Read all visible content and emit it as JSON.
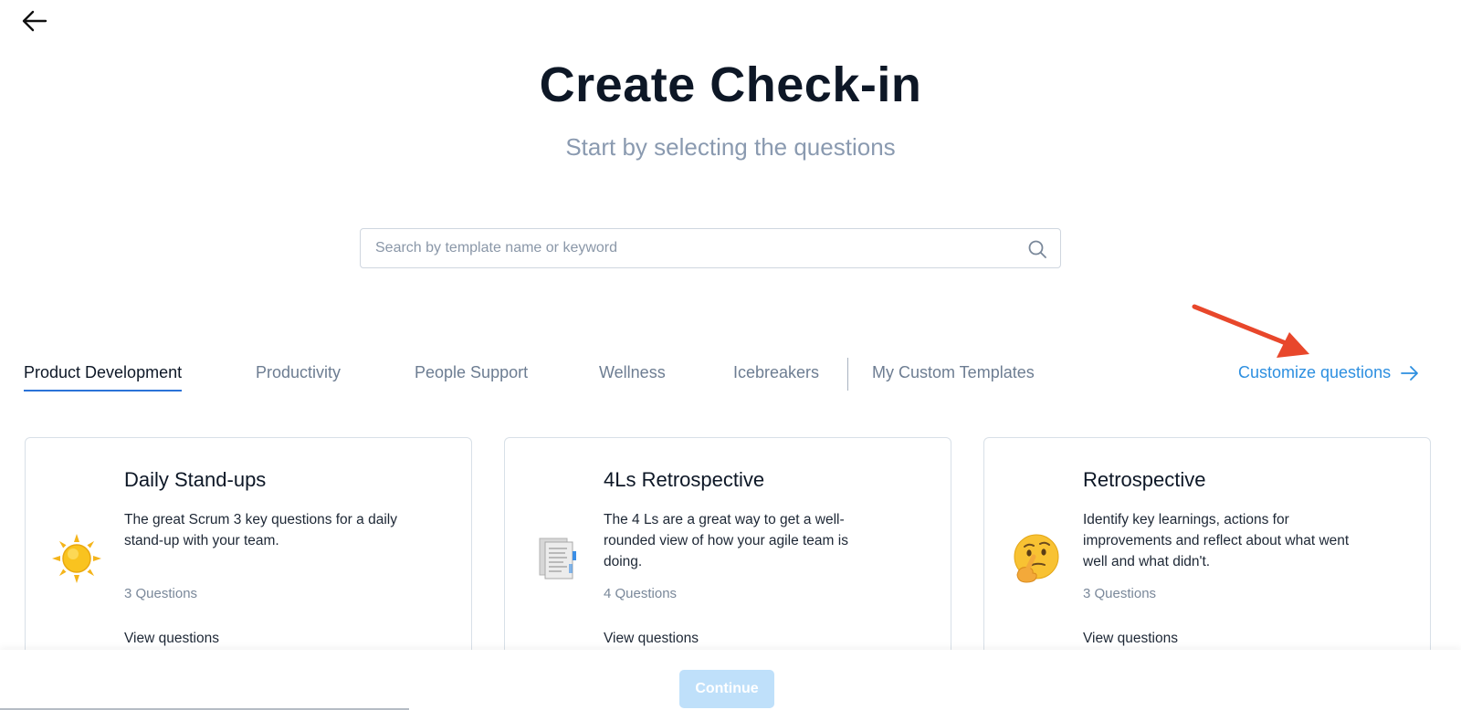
{
  "header": {
    "title": "Create Check-in",
    "subtitle": "Start by selecting the questions"
  },
  "search": {
    "placeholder": "Search by template name or keyword",
    "value": ""
  },
  "tabs": [
    {
      "label": "Product Development",
      "active": true
    },
    {
      "label": "Productivity",
      "active": false
    },
    {
      "label": "People Support",
      "active": false
    },
    {
      "label": "Wellness",
      "active": false
    },
    {
      "label": "Icebreakers",
      "active": false
    },
    {
      "label": "My Custom Templates",
      "active": false
    }
  ],
  "customize": {
    "label": "Customize questions"
  },
  "cards": [
    {
      "title": "Daily Stand-ups",
      "description": "The great Scrum 3 key questions for a daily stand-up with your team.",
      "count": "3 Questions",
      "view_label": "View questions",
      "icon": "sun-icon"
    },
    {
      "title": "4Ls Retrospective",
      "description": "The 4 Ls are a great way to get a well-rounded view of how your agile team is doing.",
      "count": "4 Questions",
      "view_label": "View questions",
      "icon": "document-icon"
    },
    {
      "title": "Retrospective",
      "description": "Identify key learnings, actions for improvements and reflect about what went well and what didn't.",
      "count": "3 Questions",
      "view_label": "View questions",
      "icon": "thinking-face-icon"
    }
  ],
  "footer": {
    "continue_label": "Continue"
  },
  "colors": {
    "accent": "#2b73d8",
    "link": "#2d8fe0",
    "annotation_arrow": "#e8472b",
    "continue_disabled": "#bfe0fa"
  }
}
